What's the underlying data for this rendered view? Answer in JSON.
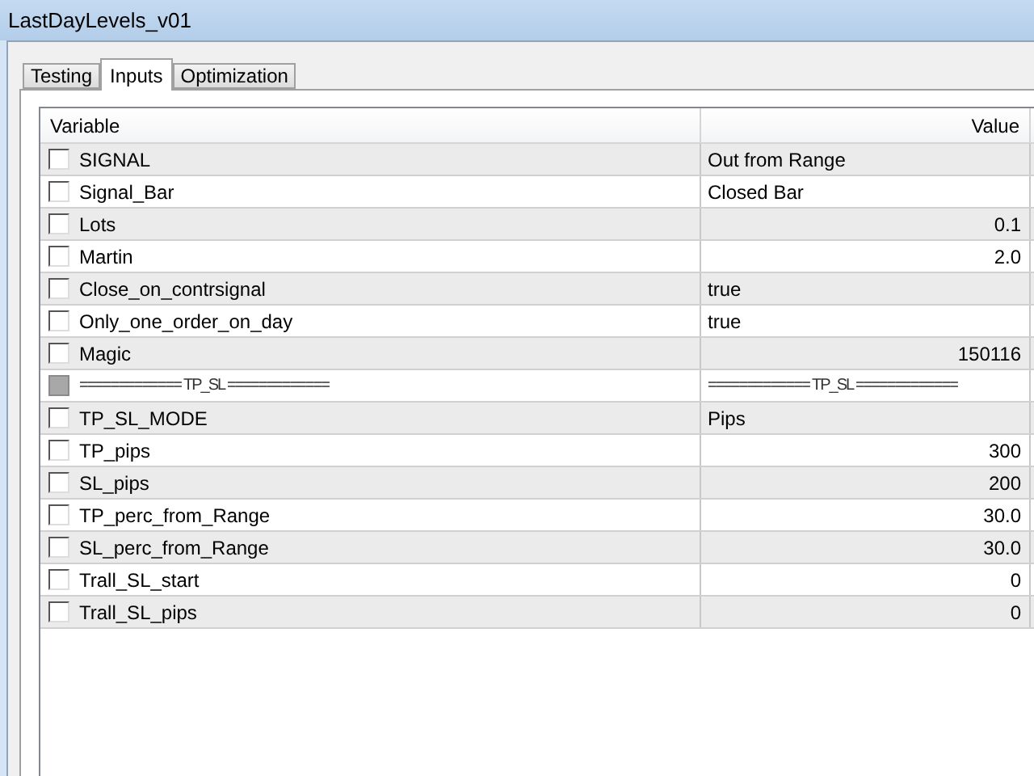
{
  "window": {
    "title": "LastDayLevels_v01"
  },
  "tabs": [
    {
      "label": "Testing",
      "selected": false
    },
    {
      "label": "Inputs",
      "selected": true
    },
    {
      "label": "Optimization",
      "selected": false
    }
  ],
  "table": {
    "columns": [
      "Variable",
      "Value"
    ],
    "rows": [
      {
        "kind": "text",
        "variable": "SIGNAL",
        "value": "Out from Range",
        "checked": false,
        "disabled": false
      },
      {
        "kind": "text",
        "variable": "Signal_Bar",
        "value": "Closed Bar",
        "checked": false,
        "disabled": false
      },
      {
        "kind": "number",
        "variable": "Lots",
        "value": "0.1",
        "checked": false,
        "disabled": false
      },
      {
        "kind": "number",
        "variable": "Martin",
        "value": "2.0",
        "checked": false,
        "disabled": false
      },
      {
        "kind": "text",
        "variable": "Close_on_contrsignal",
        "value": "true",
        "checked": false,
        "disabled": false
      },
      {
        "kind": "text",
        "variable": "Only_one_order_on_day",
        "value": "true",
        "checked": false,
        "disabled": false
      },
      {
        "kind": "number",
        "variable": "Magic",
        "value": "150116",
        "checked": false,
        "disabled": false
      },
      {
        "kind": "separator",
        "variable": "============= TP_SL =============",
        "value": "============= TP_SL =============",
        "checked": false,
        "disabled": true
      },
      {
        "kind": "text",
        "variable": "TP_SL_MODE",
        "value": "Pips",
        "checked": false,
        "disabled": false
      },
      {
        "kind": "number",
        "variable": "TP_pips",
        "value": "300",
        "checked": false,
        "disabled": false
      },
      {
        "kind": "number",
        "variable": "SL_pips",
        "value": "200",
        "checked": false,
        "disabled": false
      },
      {
        "kind": "number",
        "variable": "TP_perc_from_Range",
        "value": "30.0",
        "checked": false,
        "disabled": false
      },
      {
        "kind": "number",
        "variable": "SL_perc_from_Range",
        "value": "30.0",
        "checked": false,
        "disabled": false
      },
      {
        "kind": "number",
        "variable": "Trall_SL_start",
        "value": "0",
        "checked": false,
        "disabled": false
      },
      {
        "kind": "number",
        "variable": "Trall_SL_pips",
        "value": "0",
        "checked": false,
        "disabled": false
      }
    ]
  }
}
